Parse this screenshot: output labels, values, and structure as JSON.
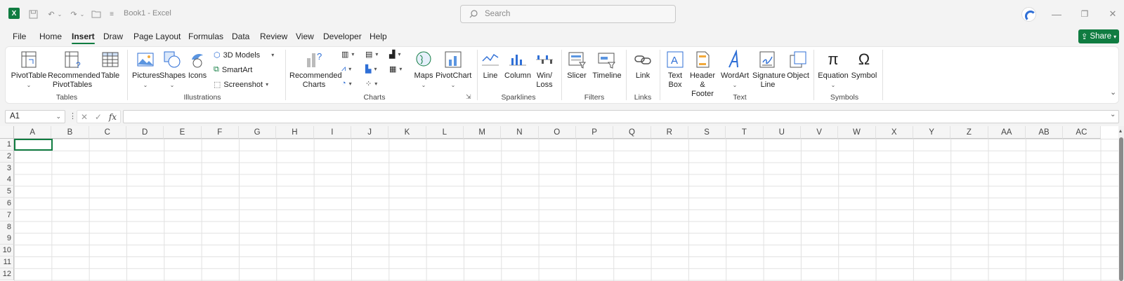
{
  "window": {
    "title": "Book1 - Excel",
    "search_placeholder": "Search",
    "minimize": "—",
    "restore": "❐",
    "close": "✕"
  },
  "menu": {
    "tabs": [
      "File",
      "Home",
      "Insert",
      "Draw",
      "Page Layout",
      "Formulas",
      "Data",
      "Review",
      "View",
      "Developer",
      "Help"
    ],
    "active": "Insert",
    "share_label": "Share"
  },
  "ribbon": {
    "tables": {
      "label": "Tables",
      "buttons": [
        "PivotTable",
        "Recommended PivotTables",
        "Table"
      ]
    },
    "illustrations": {
      "label": "Illustrations",
      "buttons": [
        "Pictures",
        "Shapes",
        "Icons"
      ],
      "small": [
        "3D Models",
        "SmartArt",
        "Screenshot"
      ]
    },
    "charts": {
      "label": "Charts",
      "buttons": [
        "Recommended Charts",
        "Maps",
        "PivotChart"
      ]
    },
    "sparklines": {
      "label": "Sparklines",
      "buttons": [
        "Line",
        "Column",
        "Win/ Loss"
      ]
    },
    "filters": {
      "label": "Filters",
      "buttons": [
        "Slicer",
        "Timeline"
      ]
    },
    "links": {
      "label": "Links",
      "buttons": [
        "Link"
      ]
    },
    "text": {
      "label": "Text",
      "buttons": [
        "Text Box",
        "Header & Footer",
        "WordArt",
        "Signature Line",
        "Object"
      ]
    },
    "symbols": {
      "label": "Symbols",
      "buttons": [
        "Equation",
        "Symbol"
      ]
    }
  },
  "formula_bar": {
    "name_box": "A1",
    "fx": "fx",
    "value": ""
  },
  "sheet": {
    "columns": [
      "A",
      "B",
      "C",
      "D",
      "E",
      "F",
      "G",
      "H",
      "I",
      "J",
      "K",
      "L",
      "M",
      "N",
      "O",
      "P",
      "Q",
      "R",
      "S",
      "T",
      "U",
      "V",
      "W",
      "X",
      "Y",
      "Z",
      "AA",
      "AB",
      "AC"
    ],
    "rows": [
      "1",
      "2",
      "3",
      "4",
      "5",
      "6",
      "7",
      "8",
      "9",
      "10",
      "11",
      "12"
    ]
  },
  "colors": {
    "accent": "#107c41"
  }
}
